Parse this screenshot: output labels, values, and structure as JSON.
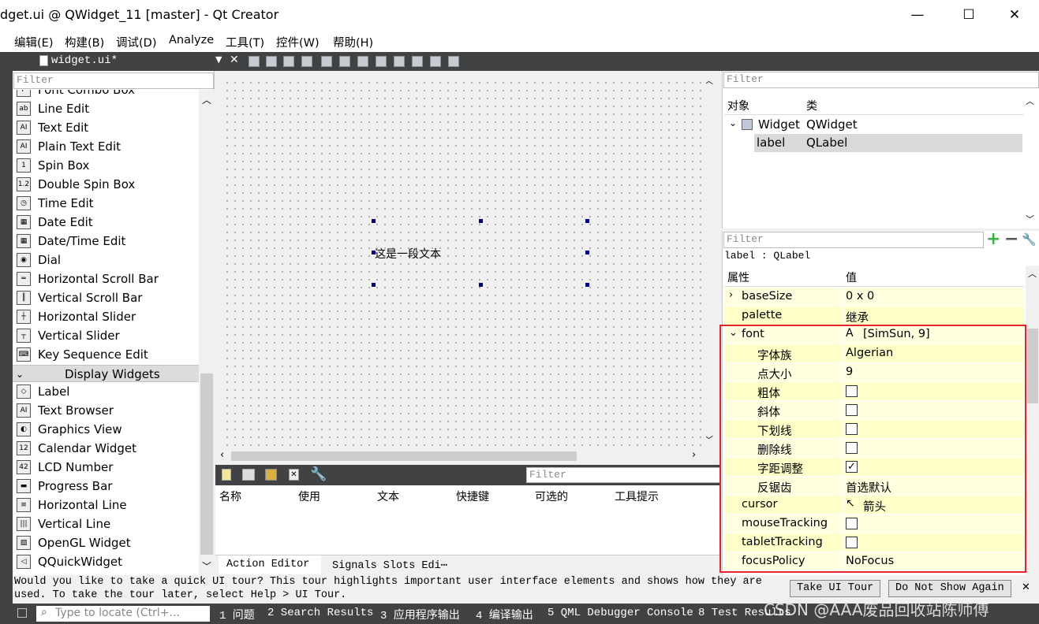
{
  "window": {
    "title": "dget.ui @ QWidget_11 [master] - Qt Creator",
    "minimize": "—",
    "maximize": "☐",
    "close": "✕"
  },
  "menu": [
    "编辑(E)",
    "构建(B)",
    "调试(D)",
    "Analyze",
    "工具(T)",
    "控件(W)",
    "帮助(H)"
  ],
  "editor": {
    "file_tab": "widget.ui*",
    "close": "✕"
  },
  "widget_box": {
    "filter_placeholder": "Filter",
    "items_top": [
      {
        "label": "Font Combo Box",
        "icon": "F"
      },
      {
        "label": "Line Edit",
        "icon": "ab"
      },
      {
        "label": "Text Edit",
        "icon": "AI"
      },
      {
        "label": "Plain Text Edit",
        "icon": "AI"
      },
      {
        "label": "Spin Box",
        "icon": "1"
      },
      {
        "label": "Double Spin Box",
        "icon": "1.2"
      },
      {
        "label": "Time Edit",
        "icon": "◷"
      },
      {
        "label": "Date Edit",
        "icon": "▦"
      },
      {
        "label": "Date/Time Edit",
        "icon": "▦"
      },
      {
        "label": "Dial",
        "icon": "◉"
      },
      {
        "label": "Horizontal Scroll Bar",
        "icon": "═"
      },
      {
        "label": "Vertical Scroll Bar",
        "icon": "║"
      },
      {
        "label": "Horizontal Slider",
        "icon": "┼"
      },
      {
        "label": "Vertical Slider",
        "icon": "┬"
      },
      {
        "label": "Key Sequence Edit",
        "icon": "⌨"
      }
    ],
    "category": "Display Widgets",
    "items_display": [
      {
        "label": "Label",
        "icon": "◇"
      },
      {
        "label": "Text Browser",
        "icon": "AI"
      },
      {
        "label": "Graphics View",
        "icon": "◐"
      },
      {
        "label": "Calendar Widget",
        "icon": "12"
      },
      {
        "label": "LCD Number",
        "icon": "42"
      },
      {
        "label": "Progress Bar",
        "icon": "▬"
      },
      {
        "label": "Horizontal Line",
        "icon": "≡"
      },
      {
        "label": "Vertical Line",
        "icon": "|||"
      },
      {
        "label": "OpenGL Widget",
        "icon": "▧"
      },
      {
        "label": "QQuickWidget",
        "icon": "◁"
      }
    ]
  },
  "form": {
    "label_text": "这是一段文本"
  },
  "action_editor": {
    "filter_placeholder": "Filter",
    "columns": [
      "名称",
      "使用",
      "文本",
      "快捷键",
      "可选的",
      "工具提示"
    ],
    "tabs": [
      "Action Editor",
      "Signals  Slots Edi⋯"
    ]
  },
  "object_inspector": {
    "filter_placeholder": "Filter",
    "col_object": "对象",
    "col_class": "类",
    "rows": [
      {
        "object": "Widget",
        "class": "QWidget"
      },
      {
        "object": "label",
        "class": "QLabel"
      }
    ]
  },
  "property_editor": {
    "filter_placeholder": "Filter",
    "context": "label : QLabel",
    "col_property": "属性",
    "col_value": "值",
    "rows": [
      {
        "name": "baseSize",
        "value": "0 x 0",
        "expander": "›",
        "indent": 0
      },
      {
        "name": "palette",
        "value": "继承",
        "indent": 0
      },
      {
        "name": "font",
        "value": "[SimSun, 9]",
        "expander": "⌄",
        "indent": 0,
        "value_icon": "A"
      },
      {
        "name": "字体族",
        "value": "Algerian",
        "indent": 1
      },
      {
        "name": "点大小",
        "value": "9",
        "indent": 1
      },
      {
        "name": "粗体",
        "checkbox": false,
        "indent": 1
      },
      {
        "name": "斜体",
        "checkbox": false,
        "indent": 1
      },
      {
        "name": "下划线",
        "checkbox": false,
        "indent": 1
      },
      {
        "name": "删除线",
        "checkbox": false,
        "indent": 1
      },
      {
        "name": "字距调整",
        "checkbox": true,
        "indent": 1
      },
      {
        "name": "反锯齿",
        "value": "首选默认",
        "indent": 1
      },
      {
        "name": "cursor",
        "value": "箭头",
        "indent": 0,
        "value_icon": "↖"
      },
      {
        "name": "mouseTracking",
        "checkbox": false,
        "indent": 0
      },
      {
        "name": "tabletTracking",
        "checkbox": false,
        "indent": 0
      },
      {
        "name": "focusPolicy",
        "value": "NoFocus",
        "indent": 0
      }
    ]
  },
  "tour": {
    "line1": "Would you like to take a quick UI tour? This tour highlights important user interface elements and shows how they are",
    "line2": "used. To take the tour later, select Help > UI Tour.",
    "take_button": "Take UI Tour",
    "dismiss_button": "Do Not Show Again",
    "close": "✕"
  },
  "statusbar": {
    "locate_placeholder": "Type to locate (Ctrl+...",
    "panes": [
      "1 问题",
      "2 Search Results",
      "3 应用程序输出",
      "4 编译输出",
      "5 QML Debugger Console",
      "8 Test Results"
    ]
  },
  "watermark": "CSDN @AAA废品回收站陈师傅",
  "colors": {
    "dark_panel": "#404244",
    "property_row": "#ffffe0",
    "property_row_alt": "#ffffc8",
    "highlight_box": "#e0262a",
    "selection": "#d9d9d9",
    "handle": "#00008b"
  }
}
